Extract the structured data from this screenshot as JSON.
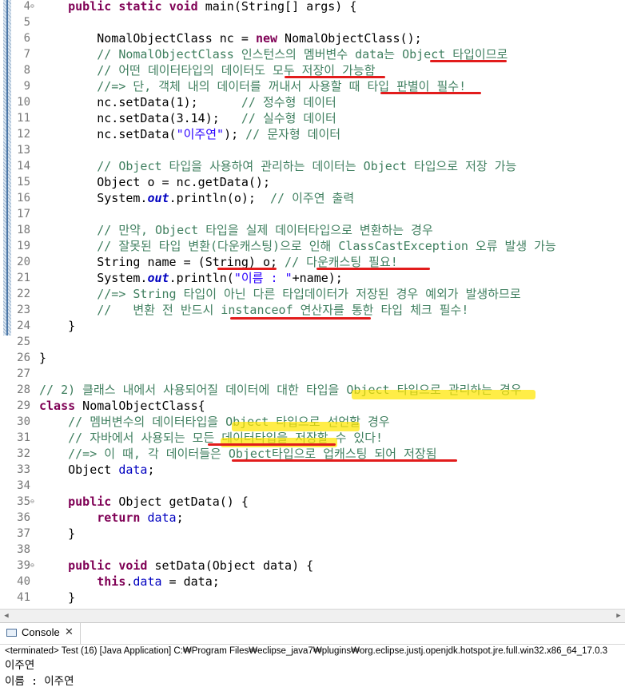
{
  "editor": {
    "lines": [
      {
        "n": "4",
        "fold": true,
        "tokens": [
          {
            "t": "    "
          },
          {
            "t": "public",
            "c": "kw"
          },
          {
            "t": " "
          },
          {
            "t": "static",
            "c": "kw"
          },
          {
            "t": " "
          },
          {
            "t": "void",
            "c": "kw"
          },
          {
            "t": " main(String[] args) {"
          }
        ]
      },
      {
        "n": "5",
        "tokens": []
      },
      {
        "n": "6",
        "tokens": [
          {
            "t": "        NomalObjectClass nc = "
          },
          {
            "t": "new",
            "c": "kw"
          },
          {
            "t": " NomalObjectClass();"
          }
        ]
      },
      {
        "n": "7",
        "tokens": [
          {
            "t": "        // NomalObjectClass 인스턴스의 멤버변수 data는 Object 타입이므로",
            "c": "cm"
          }
        ]
      },
      {
        "n": "8",
        "tokens": [
          {
            "t": "        // 어떤 데이터타입의 데이터도 모두 저장이 가능함",
            "c": "cm"
          }
        ]
      },
      {
        "n": "9",
        "tokens": [
          {
            "t": "        //=> 단, 객체 내의 데이터를 꺼내서 사용할 때 타입 판별이 필수!",
            "c": "cm"
          }
        ]
      },
      {
        "n": "10",
        "tokens": [
          {
            "t": "        nc.setData(1);      "
          },
          {
            "t": "// 정수형 데이터",
            "c": "cm"
          }
        ]
      },
      {
        "n": "11",
        "tokens": [
          {
            "t": "        nc.setData(3.14);   "
          },
          {
            "t": "// 실수형 데이터",
            "c": "cm"
          }
        ]
      },
      {
        "n": "12",
        "tokens": [
          {
            "t": "        nc.setData("
          },
          {
            "t": "\"이주연\"",
            "c": "str"
          },
          {
            "t": "); "
          },
          {
            "t": "// 문자형 데이터",
            "c": "cm"
          }
        ]
      },
      {
        "n": "13",
        "tokens": []
      },
      {
        "n": "14",
        "tokens": [
          {
            "t": "        // Object 타입을 사용하여 관리하는 데이터는 Object 타입으로 저장 가능",
            "c": "cm"
          }
        ]
      },
      {
        "n": "15",
        "tokens": [
          {
            "t": "        Object o = nc.getData();"
          }
        ]
      },
      {
        "n": "16",
        "tokens": [
          {
            "t": "        System."
          },
          {
            "t": "out",
            "c": "sfld"
          },
          {
            "t": ".println(o);  "
          },
          {
            "t": "// 이주연 출력",
            "c": "cm"
          }
        ]
      },
      {
        "n": "17",
        "tokens": []
      },
      {
        "n": "18",
        "tokens": [
          {
            "t": "        // 만약, Object 타입을 실제 데이터타입으로 변환하는 경우",
            "c": "cm"
          }
        ]
      },
      {
        "n": "19",
        "tokens": [
          {
            "t": "        // 잘못된 타입 변환(다운캐스팅)으로 인해 ClassCastException 오류 발생 가능",
            "c": "cm"
          }
        ]
      },
      {
        "n": "20",
        "tokens": [
          {
            "t": "        String name = (String) o; "
          },
          {
            "t": "// 다운캐스팅 필요!",
            "c": "cm"
          }
        ]
      },
      {
        "n": "21",
        "tokens": [
          {
            "t": "        System."
          },
          {
            "t": "out",
            "c": "sfld"
          },
          {
            "t": ".println("
          },
          {
            "t": "\"이름 : \"",
            "c": "str"
          },
          {
            "t": "+name);"
          }
        ]
      },
      {
        "n": "22",
        "tokens": [
          {
            "t": "        //=> String 타입이 아닌 다른 타입데이터가 저장된 경우 예외가 발생하므로",
            "c": "cm"
          }
        ]
      },
      {
        "n": "23",
        "tokens": [
          {
            "t": "        //   변환 전 반드시 instanceof 연산자를 통한 타입 체크 필수!",
            "c": "cm"
          }
        ]
      },
      {
        "n": "24",
        "tokens": [
          {
            "t": "    }"
          }
        ]
      },
      {
        "n": "25",
        "tokens": []
      },
      {
        "n": "26",
        "tokens": [
          {
            "t": "}"
          }
        ]
      },
      {
        "n": "27",
        "tokens": []
      },
      {
        "n": "28",
        "tokens": [
          {
            "t": "// 2) 클래스 내에서 사용되어질 데이터에 대한 타입을 Object 타입으로 관리하는 경우",
            "c": "cm"
          }
        ]
      },
      {
        "n": "29",
        "tokens": [
          {
            "t": "class",
            "c": "kw"
          },
          {
            "t": " NomalObjectClass{"
          }
        ]
      },
      {
        "n": "30",
        "tokens": [
          {
            "t": "    // 멤버변수의 데이터타입을 Object 타입으로 선언할 경우",
            "c": "cm"
          }
        ]
      },
      {
        "n": "31",
        "tokens": [
          {
            "t": "    // 자바에서 사용되는 모든 데이터타입을 저장할 수 있다!",
            "c": "cm"
          }
        ]
      },
      {
        "n": "32",
        "tokens": [
          {
            "t": "    //=> 이 때, 각 데이터들은 Object타입으로 업캐스팅 되어 저장됨",
            "c": "cm"
          }
        ]
      },
      {
        "n": "33",
        "tokens": [
          {
            "t": "    Object "
          },
          {
            "t": "data",
            "c": "fld"
          },
          {
            "t": ";"
          }
        ]
      },
      {
        "n": "34",
        "tokens": []
      },
      {
        "n": "35",
        "fold": true,
        "tokens": [
          {
            "t": "    "
          },
          {
            "t": "public",
            "c": "kw"
          },
          {
            "t": " Object getData() {"
          }
        ]
      },
      {
        "n": "36",
        "tokens": [
          {
            "t": "        "
          },
          {
            "t": "return",
            "c": "kw"
          },
          {
            "t": " "
          },
          {
            "t": "data",
            "c": "fld"
          },
          {
            "t": ";"
          }
        ]
      },
      {
        "n": "37",
        "tokens": [
          {
            "t": "    }"
          }
        ]
      },
      {
        "n": "38",
        "tokens": []
      },
      {
        "n": "39",
        "fold": true,
        "tokens": [
          {
            "t": "    "
          },
          {
            "t": "public",
            "c": "kw"
          },
          {
            "t": " "
          },
          {
            "t": "void",
            "c": "kw"
          },
          {
            "t": " setData(Object data) {"
          }
        ]
      },
      {
        "n": "40",
        "tokens": [
          {
            "t": "        "
          },
          {
            "t": "this",
            "c": "kw"
          },
          {
            "t": "."
          },
          {
            "t": "data",
            "c": "fld"
          },
          {
            "t": " = data;"
          }
        ]
      },
      {
        "n": "41",
        "tokens": [
          {
            "t": "    }"
          }
        ]
      }
    ]
  },
  "console": {
    "tab_label": "Console",
    "close_glyph": "✕",
    "status": "<terminated> Test (16) [Java Application] C:₩Program Files₩eclipse_java7₩plugins₩org.eclipse.justj.openjdk.hotspot.jre.full.win32.x86_64_17.0.3",
    "output": [
      "이주연",
      "이름 : 이주연"
    ]
  },
  "annotations": {
    "underline_color": "#e21c1c",
    "highlight_color": "#ffe600"
  }
}
